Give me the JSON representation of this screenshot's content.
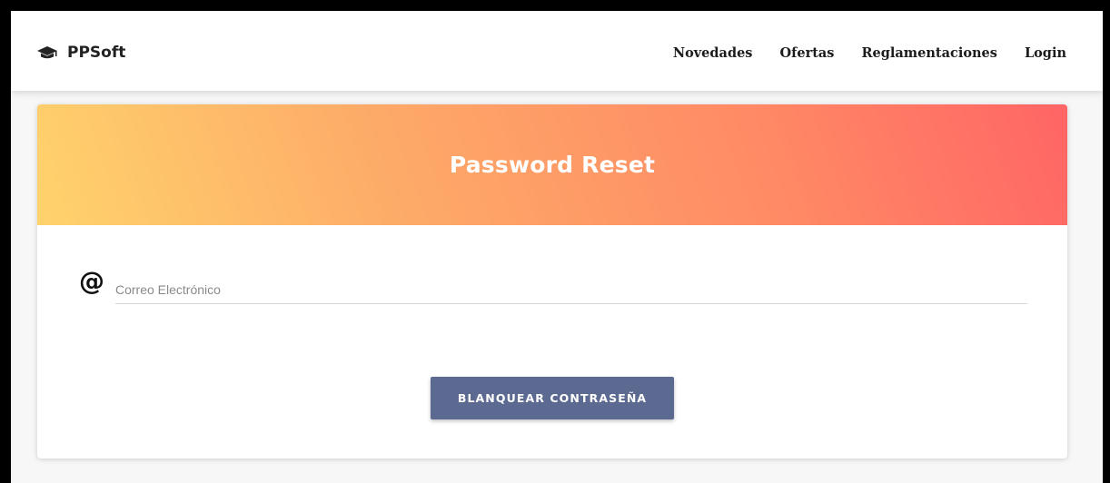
{
  "brand": {
    "name": "PPSoft",
    "icon": "graduation-cap-icon"
  },
  "nav": {
    "items": [
      {
        "label": "Novedades"
      },
      {
        "label": "Ofertas"
      },
      {
        "label": "Reglamentaciones"
      },
      {
        "label": "Login"
      }
    ]
  },
  "card": {
    "title": "Password Reset",
    "header_gradient": [
      "#ffd36c",
      "#fdaa68",
      "#ff8a65",
      "#ff6565"
    ]
  },
  "form": {
    "email_icon": "at-sign-icon",
    "email_icon_glyph": "@",
    "email_placeholder": "Correo Electrónico",
    "email_value": "",
    "submit_label": "BLANQUEAR CONTRASEÑA",
    "submit_color": "#5c6a92"
  }
}
